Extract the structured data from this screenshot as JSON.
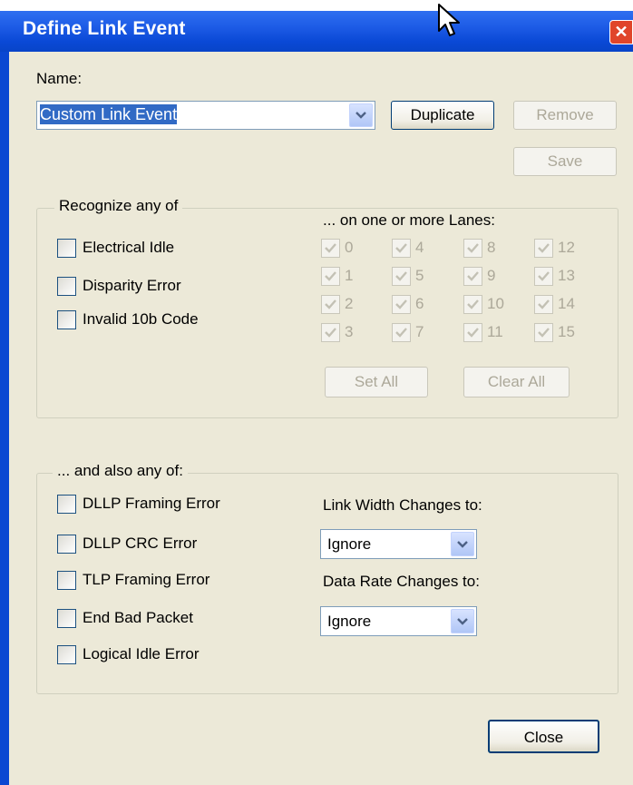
{
  "window": {
    "title": "Define Link Event"
  },
  "name_section": {
    "label": "Name:",
    "selected_name": "Custom Link Event",
    "duplicate_label": "Duplicate",
    "remove_label": "Remove",
    "save_label": "Save"
  },
  "recognize_group": {
    "legend": "Recognize any of",
    "lanes_caption": "... on one or more Lanes:",
    "items": [
      {
        "label": "Electrical Idle",
        "checked": false
      },
      {
        "label": "Disparity Error",
        "checked": false
      },
      {
        "label": "Invalid 10b Code",
        "checked": false
      }
    ],
    "lanes": [
      "0",
      "1",
      "2",
      "3",
      "4",
      "5",
      "6",
      "7",
      "8",
      "9",
      "10",
      "11",
      "12",
      "13",
      "14",
      "15"
    ],
    "lanes_checked": true,
    "set_all_label": "Set All",
    "clear_all_label": "Clear All"
  },
  "also_group": {
    "legend": "... and also any of:",
    "items": [
      {
        "label": "DLLP Framing Error",
        "checked": false
      },
      {
        "label": "DLLP CRC Error",
        "checked": false
      },
      {
        "label": "TLP Framing Error",
        "checked": false
      },
      {
        "label": "End Bad Packet",
        "checked": false
      },
      {
        "label": "Logical Idle Error",
        "checked": false
      }
    ],
    "link_width_label": "Link Width Changes to:",
    "link_width_value": "Ignore",
    "data_rate_label": "Data Rate Changes to:",
    "data_rate_value": "Ignore"
  },
  "footer": {
    "close_label": "Close"
  },
  "colors": {
    "title_bar": "#0a49d6",
    "dialog_face": "#ece9d8",
    "selection": "#316ac5",
    "disabled_text": "#aca899"
  }
}
